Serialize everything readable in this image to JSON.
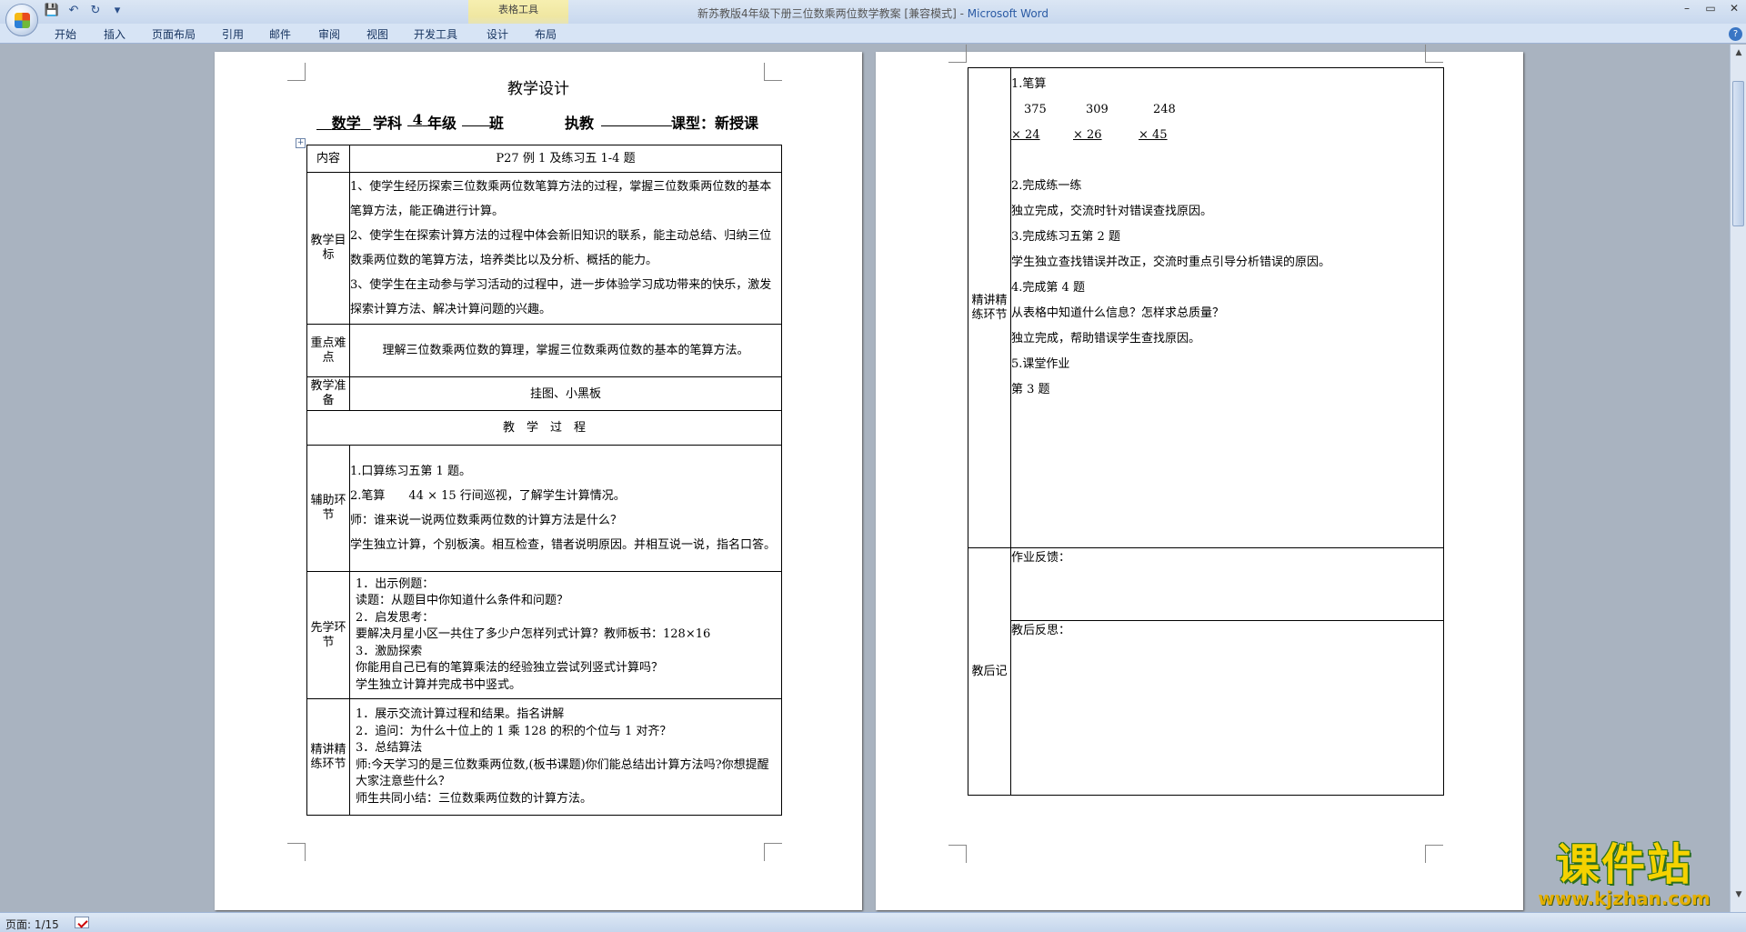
{
  "window": {
    "title_doc": "新苏教版4年级下册三位数乘两位数学教案 [兼容模式] - ",
    "title_app": "Microsoft Word",
    "context_tab": "表格工具",
    "min": "–",
    "max": "▭",
    "close": "✕"
  },
  "qat": {
    "save": "💾",
    "undo": "↶",
    "redo": "↻",
    "more": "▾"
  },
  "ribbon": {
    "tabs": [
      "开始",
      "插入",
      "页面布局",
      "引用",
      "邮件",
      "审阅",
      "视图",
      "开发工具",
      "设计",
      "布局"
    ]
  },
  "doc": {
    "title": "教学设计",
    "info": {
      "subject": "数学",
      "subject_suffix": "学科",
      "grade": "4",
      "grade_suffix": "年级",
      "class_suffix": "班",
      "teacher_label": "执教",
      "lesson_type": "课型：新授课"
    },
    "rows": {
      "content_label": "内容",
      "content": "P27 例 1 及练习五 1-4 题",
      "goals_label": "教学目标",
      "goals": [
        "1、使学生经历探索三位数乘两位数笔算方法的过程，掌握三位数乘两位数的基本笔算方法，能正确进行计算。",
        "2、使学生在探索计算方法的过程中体会新旧知识的联系，能主动总结、归纳三位数乘两位数的笔算方法，培养类比以及分析、概括的能力。",
        "3、使学生在主动参与学习活动的过程中，进一步体验学习成功带来的快乐，激发探索计算方法、解决计算问题的兴趣。"
      ],
      "key_label": "重点难点",
      "key": "理解三位数乘两位数的算理，掌握三位数乘两位数的基本的笔算方法。",
      "prep_label": "教学准备",
      "prep": "挂图、小黑板",
      "process": "教　学　过　程",
      "aux_label": "辅助环节",
      "aux": [
        "1.口算练习五第 1 题。",
        "2.笔算　　44 × 15  行间巡视，了解学生计算情况。",
        "师：谁来说一说两位数乘两位数的计算方法是什么？",
        "学生独立计算，个别板演。相互检查，错者说明原因。并相互说一说，指名口答。"
      ],
      "pre_label": "先学环节",
      "pre": [
        "1．出示例题：",
        "读题：从题目中你知道什么条件和问题？",
        "2．启发思考：",
        "要解决月星小区一共住了多少户怎样列式计算？教师板书：128×16",
        "3．激励探索",
        "你能用自己已有的笔算乘法的经验独立尝试列竖式计算吗？",
        "学生独立计算并完成书中竖式。"
      ],
      "intense_label": "精讲精练环节",
      "intense": [
        "1．展示交流计算过程和结果。指名讲解",
        "2．追问：为什么十位上的 1 乘 128 的积的个位与 1 对齐？",
        "3．总结算法",
        "师:今天学习的是三位数乘两位数,(板书课题)你们能总结出计算方法吗?你想提醒大家注意些什么？",
        "师生共同小结：三位数乘两位数的计算方法。"
      ]
    },
    "page2": {
      "intense_label": "精讲精练环节",
      "calc_title": "1.笔算",
      "calc_nums": [
        "375",
        "309",
        "248"
      ],
      "calc_muls": [
        "×  24",
        "×  26",
        "×  45"
      ],
      "items": [
        "2.完成练一练",
        "独立完成，交流时针对错误查找原因。",
        "3.完成练习五第 2 题",
        "学生独立查找错误并改正，交流时重点引导分析错误的原因。",
        "4.完成第 4 题",
        "从表格中知道什么信息？怎样求总质量？",
        "独立完成，帮助错误学生查找原因。",
        "5.课堂作业",
        "第 3 题"
      ],
      "feedback": "作业反馈：",
      "after_label": "教后记",
      "reflection": "教后反思："
    }
  },
  "status": {
    "page": "页面: 1/15"
  },
  "watermark": {
    "cn": "课件站",
    "url": "www.kjzhan.com"
  }
}
